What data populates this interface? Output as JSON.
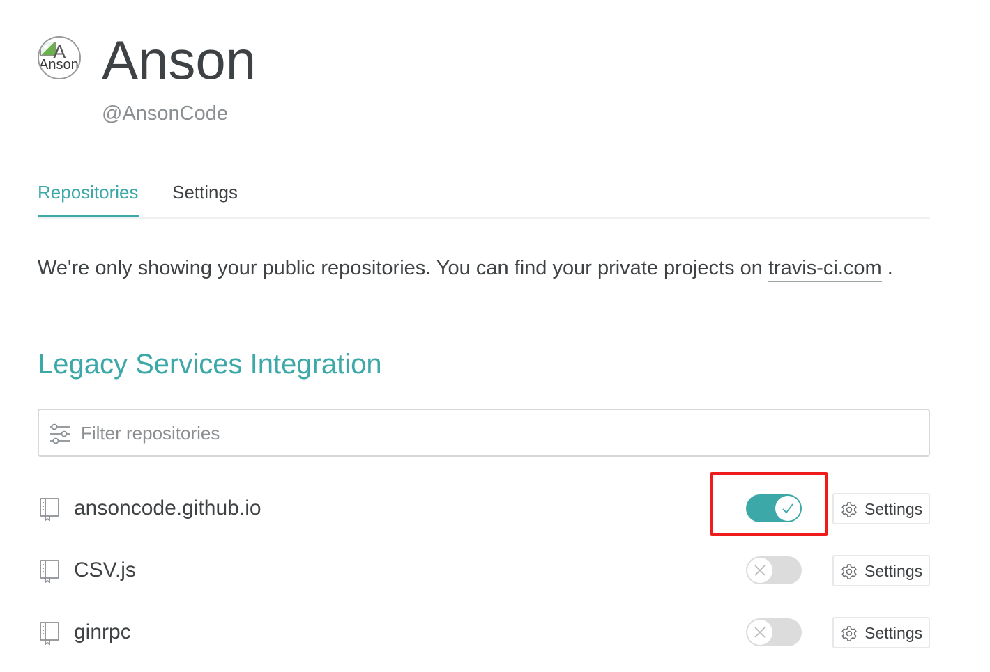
{
  "profile": {
    "avatar_alt": "Anson",
    "avatar_letter": "A",
    "name": "Anson",
    "handle": "@AnsonCode"
  },
  "tabs": [
    {
      "label": "Repositories",
      "active": true
    },
    {
      "label": "Settings",
      "active": false
    }
  ],
  "notice": {
    "text": "We're only showing your public repositories. You can find your private projects on ",
    "link_text": "travis-ci.com",
    "suffix": " ."
  },
  "section_title": "Legacy Services Integration",
  "filter": {
    "placeholder": "Filter repositories",
    "icon": "sliders-icon"
  },
  "repositories": [
    {
      "name": "ansoncode.github.io",
      "enabled": true,
      "settings_label": "Settings",
      "icon": "repo-book-icon"
    },
    {
      "name": "CSV.js",
      "enabled": false,
      "settings_label": "Settings",
      "icon": "repo-book-icon"
    },
    {
      "name": "ginrpc",
      "enabled": false,
      "settings_label": "Settings",
      "icon": "repo-book-icon"
    }
  ],
  "colors": {
    "accent": "#3da8a8",
    "text": "#3f4244",
    "muted": "#8b8f92",
    "highlight": "#ee1c1c"
  }
}
